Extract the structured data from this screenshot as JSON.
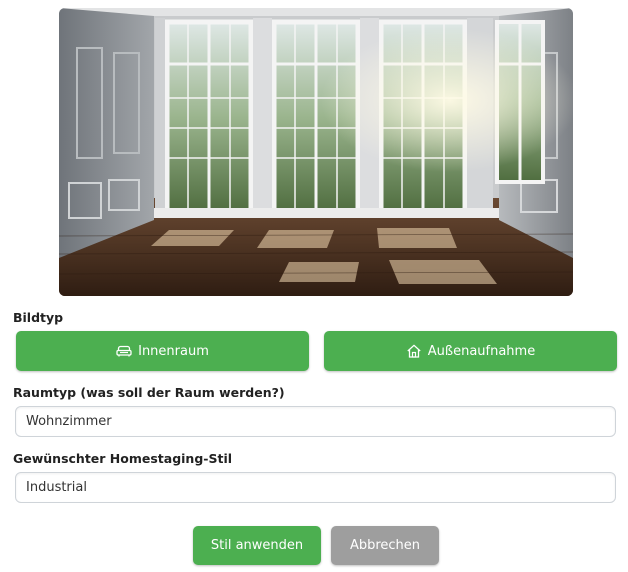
{
  "image": {
    "alt": "room-photo"
  },
  "bildtyp": {
    "label": "Bildtyp",
    "options": [
      {
        "label": "Innenraum",
        "icon": "sofa-icon"
      },
      {
        "label": "Außenaufnahme",
        "icon": "house-icon"
      }
    ]
  },
  "raumtyp": {
    "label": "Raumtyp (was soll der Raum werden?)",
    "value": "Wohnzimmer"
  },
  "stil": {
    "label": "Gewünschter Homestaging-Stil",
    "value": "Industrial"
  },
  "actions": {
    "apply_label": "Stil anwenden",
    "cancel_label": "Abbrechen"
  },
  "colors": {
    "primary": "#4caf50",
    "secondary": "#9e9e9e"
  }
}
